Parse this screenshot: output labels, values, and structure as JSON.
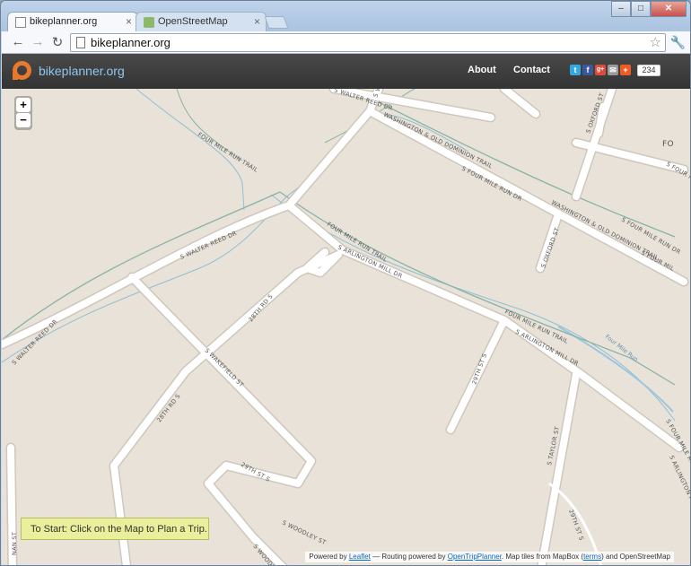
{
  "browser": {
    "tabs": [
      {
        "title": "bikeplanner.org",
        "active": true
      },
      {
        "title": "OpenStreetMap",
        "active": false
      }
    ],
    "url": "bikeplanner.org",
    "window_buttons": {
      "minimize": "–",
      "maximize": "□",
      "close": "✕"
    }
  },
  "site": {
    "brand": "bikeplanner.org",
    "nav": {
      "about": "About",
      "contact": "Contact"
    },
    "share_count": "234",
    "colors": {
      "brand_orange": "#e8782e",
      "header_bg": "#3d3d3d",
      "brand_text": "#8fc6f0"
    }
  },
  "map": {
    "zoom_in": "+",
    "zoom_out": "−",
    "hint": "To Start: Click on the Map to Plan a Trip.",
    "attribution": {
      "powered_by": "Powered by",
      "leaflet": "Leaflet",
      "routing": "— Routing powered by",
      "otp": "OpenTripPlanner",
      "tiles": ". Map tiles from MapBox (",
      "terms": "terms",
      "tail": ") and OpenStreetMap"
    },
    "labels": {
      "walter_reed_top": "S WALTER REED DR",
      "walter_reed_mid": "S WALTER REED DR",
      "walter_reed_left": "S WALTER REED DR",
      "walter_top_right": "S WALTE",
      "fmr_trail_west": "FOUR MILE RUN TRAIL",
      "fmr_trail_mid": "FOUR MILE RUN TRAIL",
      "fmr_trail_east": "FOUR MILE RUN TRAIL",
      "wod_trail_1": "WASHINGTON & OLD DOMINION TRAIL",
      "wod_trail_2": "WASHINGTON & OLD DOMINION TRAIL",
      "four_mile_run_dr_1": "S FOUR MILE RUN DR",
      "four_mile_run_dr_2": "S FOUR MILE RUN DR",
      "four_mile_run_dr_3": "S FOUR MILE RUN DR",
      "four_mile_run_dr_4": "S FOUR MILE RUN DR",
      "four_mile_run_dr_5": "S FOUR MIL",
      "arlington_mill_1": "S ARLINGTON MILL DR",
      "arlington_mill_2": "S ARLINGTON MILL DR",
      "arlington_mill_3": "S ARLINGTON MILL DR",
      "oxford_1": "S OXFORD ST",
      "oxford_2": "S OXFORD ST",
      "fo": "FO",
      "rd28_1": "28TH RD S",
      "rd28_2": "28TH RD S",
      "st29_1": "29TH ST S",
      "st29_2": "29TH ST S",
      "st29_3": "29TH ST S",
      "wakefield": "S WAKEFIELD ST",
      "woodley_1": "S WOODLEY ST",
      "woodley_2": "S WOODLEY ST",
      "taylor": "S TAYLOR ST",
      "four_mile_run_stream": "Four Mile Run",
      "nan_st": "NAN ST"
    }
  }
}
